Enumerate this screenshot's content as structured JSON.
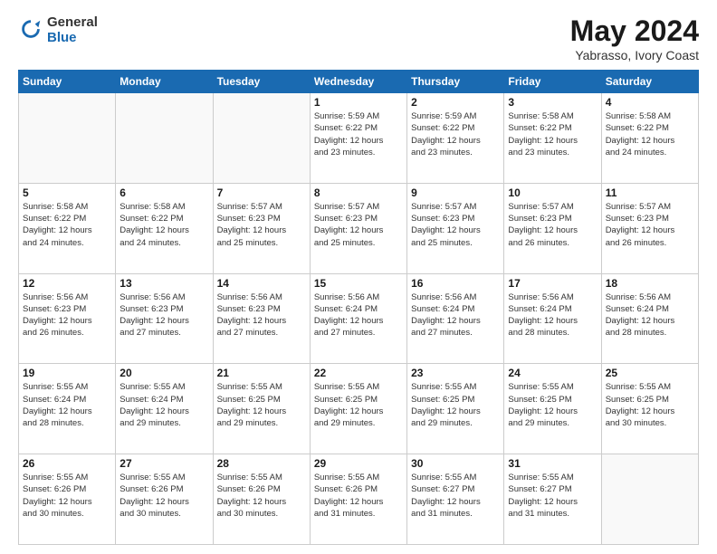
{
  "logo": {
    "general": "General",
    "blue": "Blue"
  },
  "title": "May 2024",
  "subtitle": "Yabrasso, Ivory Coast",
  "days_header": [
    "Sunday",
    "Monday",
    "Tuesday",
    "Wednesday",
    "Thursday",
    "Friday",
    "Saturday"
  ],
  "weeks": [
    [
      {
        "day": "",
        "info": ""
      },
      {
        "day": "",
        "info": ""
      },
      {
        "day": "",
        "info": ""
      },
      {
        "day": "1",
        "info": "Sunrise: 5:59 AM\nSunset: 6:22 PM\nDaylight: 12 hours\nand 23 minutes."
      },
      {
        "day": "2",
        "info": "Sunrise: 5:59 AM\nSunset: 6:22 PM\nDaylight: 12 hours\nand 23 minutes."
      },
      {
        "day": "3",
        "info": "Sunrise: 5:58 AM\nSunset: 6:22 PM\nDaylight: 12 hours\nand 23 minutes."
      },
      {
        "day": "4",
        "info": "Sunrise: 5:58 AM\nSunset: 6:22 PM\nDaylight: 12 hours\nand 24 minutes."
      }
    ],
    [
      {
        "day": "5",
        "info": "Sunrise: 5:58 AM\nSunset: 6:22 PM\nDaylight: 12 hours\nand 24 minutes."
      },
      {
        "day": "6",
        "info": "Sunrise: 5:58 AM\nSunset: 6:22 PM\nDaylight: 12 hours\nand 24 minutes."
      },
      {
        "day": "7",
        "info": "Sunrise: 5:57 AM\nSunset: 6:23 PM\nDaylight: 12 hours\nand 25 minutes."
      },
      {
        "day": "8",
        "info": "Sunrise: 5:57 AM\nSunset: 6:23 PM\nDaylight: 12 hours\nand 25 minutes."
      },
      {
        "day": "9",
        "info": "Sunrise: 5:57 AM\nSunset: 6:23 PM\nDaylight: 12 hours\nand 25 minutes."
      },
      {
        "day": "10",
        "info": "Sunrise: 5:57 AM\nSunset: 6:23 PM\nDaylight: 12 hours\nand 26 minutes."
      },
      {
        "day": "11",
        "info": "Sunrise: 5:57 AM\nSunset: 6:23 PM\nDaylight: 12 hours\nand 26 minutes."
      }
    ],
    [
      {
        "day": "12",
        "info": "Sunrise: 5:56 AM\nSunset: 6:23 PM\nDaylight: 12 hours\nand 26 minutes."
      },
      {
        "day": "13",
        "info": "Sunrise: 5:56 AM\nSunset: 6:23 PM\nDaylight: 12 hours\nand 27 minutes."
      },
      {
        "day": "14",
        "info": "Sunrise: 5:56 AM\nSunset: 6:23 PM\nDaylight: 12 hours\nand 27 minutes."
      },
      {
        "day": "15",
        "info": "Sunrise: 5:56 AM\nSunset: 6:24 PM\nDaylight: 12 hours\nand 27 minutes."
      },
      {
        "day": "16",
        "info": "Sunrise: 5:56 AM\nSunset: 6:24 PM\nDaylight: 12 hours\nand 27 minutes."
      },
      {
        "day": "17",
        "info": "Sunrise: 5:56 AM\nSunset: 6:24 PM\nDaylight: 12 hours\nand 28 minutes."
      },
      {
        "day": "18",
        "info": "Sunrise: 5:56 AM\nSunset: 6:24 PM\nDaylight: 12 hours\nand 28 minutes."
      }
    ],
    [
      {
        "day": "19",
        "info": "Sunrise: 5:55 AM\nSunset: 6:24 PM\nDaylight: 12 hours\nand 28 minutes."
      },
      {
        "day": "20",
        "info": "Sunrise: 5:55 AM\nSunset: 6:24 PM\nDaylight: 12 hours\nand 29 minutes."
      },
      {
        "day": "21",
        "info": "Sunrise: 5:55 AM\nSunset: 6:25 PM\nDaylight: 12 hours\nand 29 minutes."
      },
      {
        "day": "22",
        "info": "Sunrise: 5:55 AM\nSunset: 6:25 PM\nDaylight: 12 hours\nand 29 minutes."
      },
      {
        "day": "23",
        "info": "Sunrise: 5:55 AM\nSunset: 6:25 PM\nDaylight: 12 hours\nand 29 minutes."
      },
      {
        "day": "24",
        "info": "Sunrise: 5:55 AM\nSunset: 6:25 PM\nDaylight: 12 hours\nand 29 minutes."
      },
      {
        "day": "25",
        "info": "Sunrise: 5:55 AM\nSunset: 6:25 PM\nDaylight: 12 hours\nand 30 minutes."
      }
    ],
    [
      {
        "day": "26",
        "info": "Sunrise: 5:55 AM\nSunset: 6:26 PM\nDaylight: 12 hours\nand 30 minutes."
      },
      {
        "day": "27",
        "info": "Sunrise: 5:55 AM\nSunset: 6:26 PM\nDaylight: 12 hours\nand 30 minutes."
      },
      {
        "day": "28",
        "info": "Sunrise: 5:55 AM\nSunset: 6:26 PM\nDaylight: 12 hours\nand 30 minutes."
      },
      {
        "day": "29",
        "info": "Sunrise: 5:55 AM\nSunset: 6:26 PM\nDaylight: 12 hours\nand 31 minutes."
      },
      {
        "day": "30",
        "info": "Sunrise: 5:55 AM\nSunset: 6:27 PM\nDaylight: 12 hours\nand 31 minutes."
      },
      {
        "day": "31",
        "info": "Sunrise: 5:55 AM\nSunset: 6:27 PM\nDaylight: 12 hours\nand 31 minutes."
      },
      {
        "day": "",
        "info": ""
      }
    ]
  ]
}
